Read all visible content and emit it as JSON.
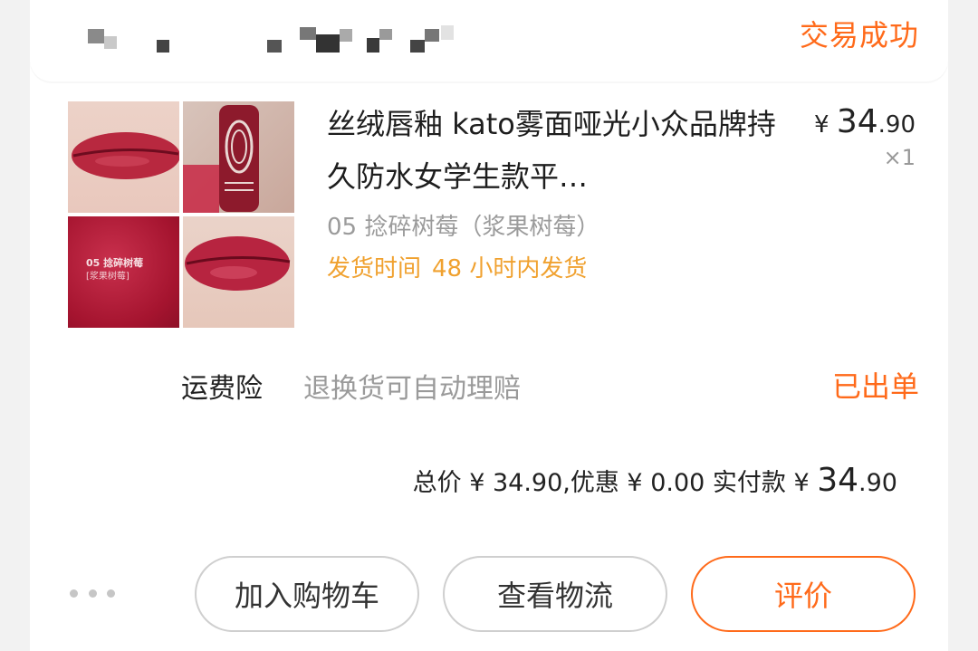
{
  "order": {
    "shop_name": "",
    "status": "交易成功"
  },
  "product": {
    "title": "丝绒唇釉 kato雾面哑光小众品牌持久防水女学生款平…",
    "price_symbol": "¥",
    "price_int": "34",
    "price_dec": ".90",
    "quantity": "×1",
    "variant": "05 捻碎树莓（浆果树莓）",
    "ship_label": "发货时间",
    "ship_time": "48 小时内发货",
    "swatch_label": "05 捻碎树莓",
    "swatch_sub": "[浆果树莓]"
  },
  "insurance": {
    "label": "运费险",
    "desc": "退换货可自动理赔",
    "status": "已出单"
  },
  "summary": {
    "prefix": "总价 ¥ 34.90,优惠 ¥ 0.00 实付款 ¥ ",
    "paid_int": "34",
    "paid_dec": ".90"
  },
  "actions": {
    "add_to_cart": "加入购物车",
    "view_logistics": "查看物流",
    "review": "评价"
  },
  "colors": {
    "accent": "#ff6a1a",
    "ship_time": "#f0a12f",
    "lip_red": "#b0183a"
  }
}
